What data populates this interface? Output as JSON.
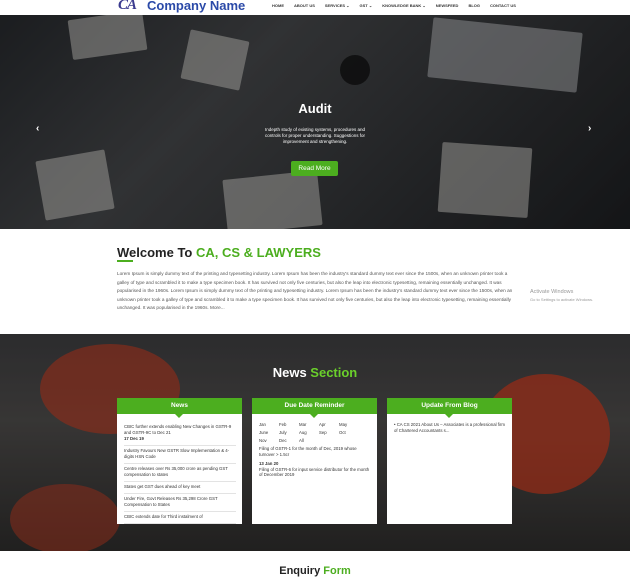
{
  "nav": {
    "logo_mark": "CA",
    "company": "Company Name",
    "menu": [
      "HOME",
      "ABOUT US",
      "SERVICES ⌄",
      "GST ⌄",
      "KNOWLEDGE BANK ⌄",
      "NEWSFEED",
      "BLOG",
      "CONTACT US"
    ]
  },
  "hero": {
    "title": "Audit",
    "description": "Indepth study of existing systems, procedures and controls for proper understanding. Suggestions for improvement and strengthening.",
    "button": "Read More",
    "prev": "‹",
    "next": "›"
  },
  "welcome": {
    "title_prefix": "Welcome To ",
    "title_highlight": "CA, CS & LAWYERS",
    "paragraph": "Lorem Ipsum is simply dummy text of the printing and typesetting industry. Lorem Ipsum has been the industry's standard dummy text ever since the 1500s, when an unknown printer took a galley of type and scrambled it to make a type specimen book. It has survived not only five centuries, but also the leap into electronic typesetting, remaining essentially unchanged. It was popularised in the 1960s. Lorem Ipsum is simply dummy text of the printing and typesetting industry. Lorem Ipsum has been the industry's standard dummy text ever since the 1500s, when an unknown printer took a galley of type and scrambled it to make a type specimen book. It has survived not only five centuries, but also the leap into electronic typesetting, remaining essentially unchanged. It was popularised in the 1960s. More..."
  },
  "watermark": {
    "title": "Activate Windows",
    "sub": "Go to Settings to activate Windows."
  },
  "news_section": {
    "title_prefix": "News ",
    "title_highlight": "Section",
    "news_card": {
      "title": "News",
      "items": [
        {
          "text": "CBIC further extends enabling New Changes in GSTR-9 and GSTR-9C to Dec 21",
          "date": "17 Dec 19"
        },
        {
          "text": "Industry Favours New GSTR Slow Implementation & 4-digits HSN Code",
          "date": ""
        },
        {
          "text": "Centre releases over Rs 35,000 crore as pending GST compensation to states",
          "date": ""
        },
        {
          "text": "States get GST dues ahead of key meet",
          "date": ""
        },
        {
          "text": "Under Fire, Govt Releases Rs 35,298 Crore GST Compensation to States",
          "date": ""
        },
        {
          "text": "CBIC extends date for Third instalment of",
          "date": ""
        }
      ]
    },
    "due_card": {
      "title": "Due Date Reminder",
      "months": [
        "Jan",
        "Feb",
        "Mar",
        "Apr",
        "May",
        "June",
        "July",
        "Aug",
        "Sep",
        "Oct",
        "Nov",
        "Dec",
        "All"
      ],
      "entries": [
        {
          "date": "",
          "text": "Filing of GSTR-1 for the month of Dec, 2019 whose turnover > 1.5cr"
        },
        {
          "date": "13 Jan 20",
          "text": "Filing of GSTR-6 for input service distributor for the month of December 2019"
        }
      ]
    },
    "blog_card": {
      "title": "Update From Blog",
      "items": [
        "CA CS 2021 About Us – Associates is a professional firm of Chartered Accountants s..."
      ]
    }
  },
  "enquiry": {
    "prefix": "Enquiry ",
    "highlight": "Form"
  },
  "colors": {
    "accent": "#4cae1f",
    "brand": "#2b4aa8"
  }
}
